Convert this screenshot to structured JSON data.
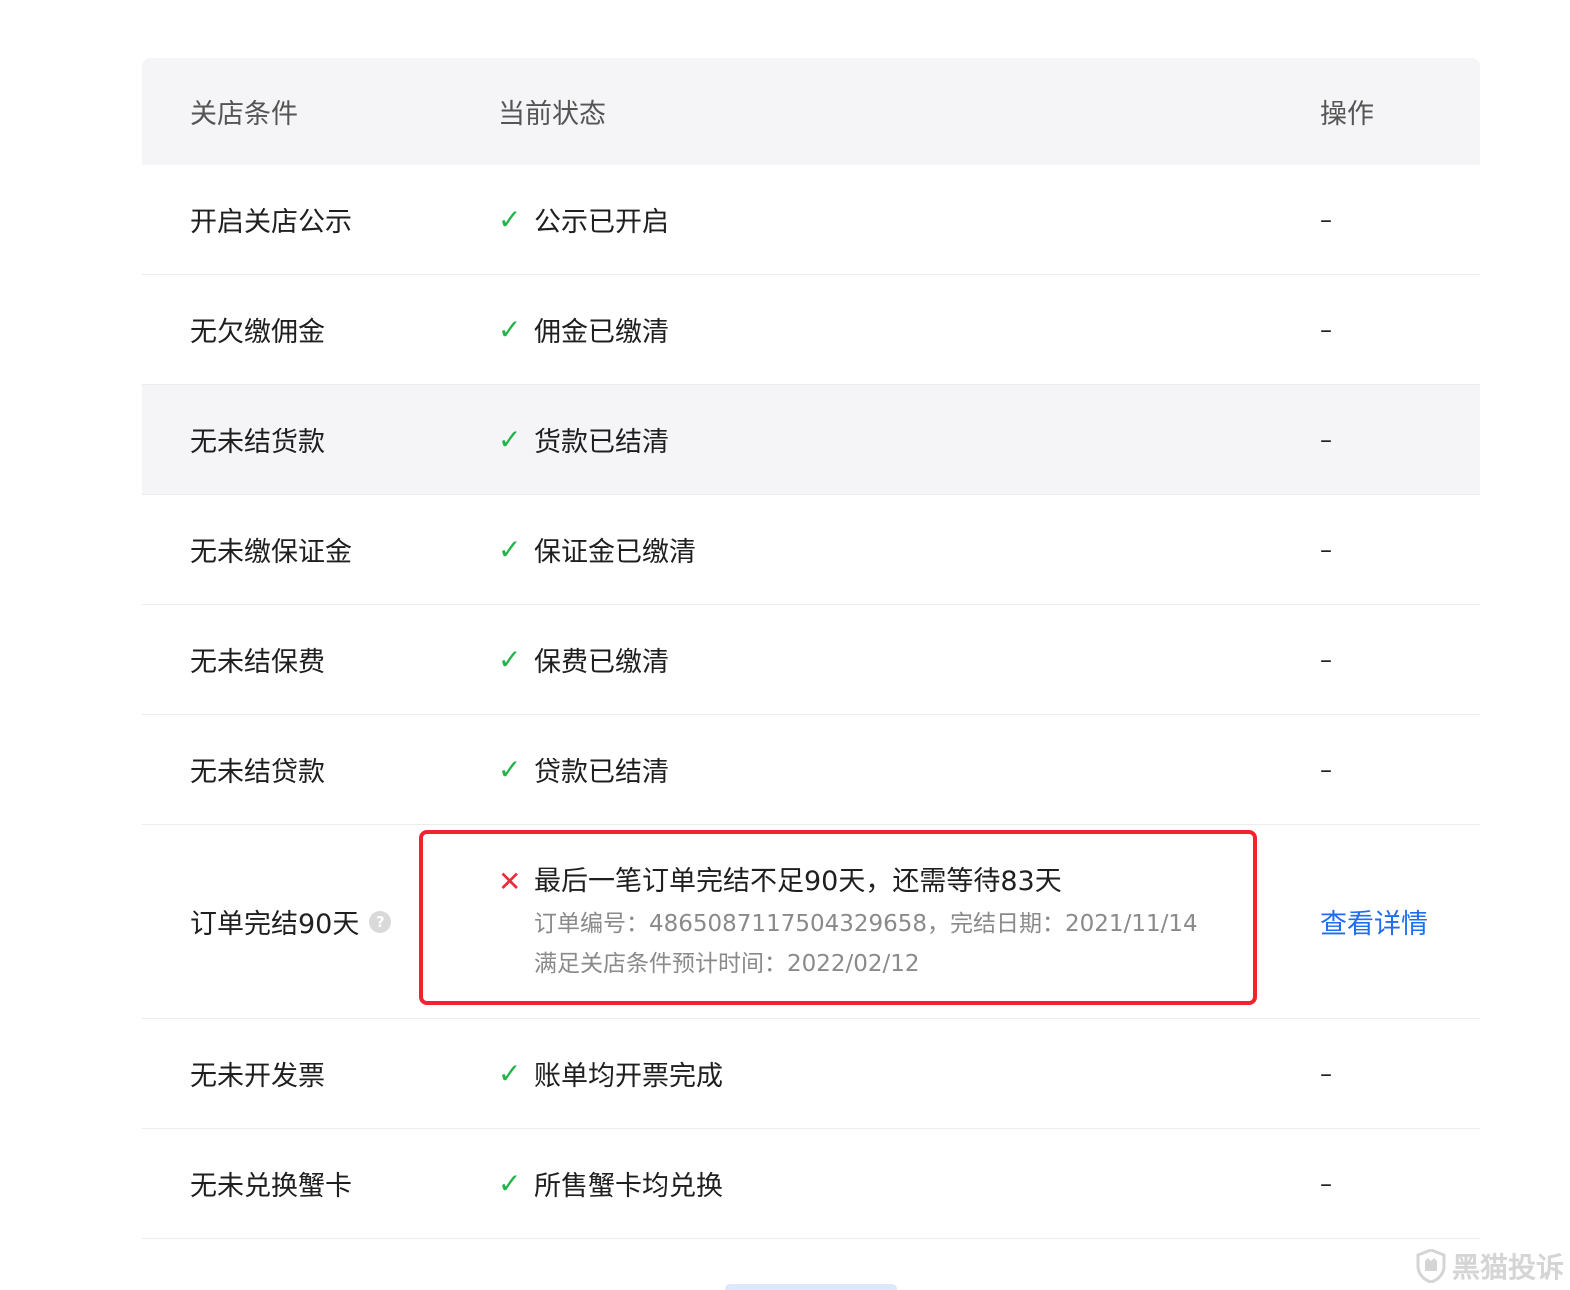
{
  "header": {
    "col_condition": "关店条件",
    "col_status": "当前状态",
    "col_action": "操作"
  },
  "rows": [
    {
      "condition": "开启关店公示",
      "status": "公示已开启",
      "action": "–"
    },
    {
      "condition": "无欠缴佣金",
      "status": "佣金已缴清",
      "action": "–"
    },
    {
      "condition": "无未结货款",
      "status": "货款已结清",
      "action": "–"
    },
    {
      "condition": "无未缴保证金",
      "status": "保证金已缴清",
      "action": "–"
    },
    {
      "condition": "无未结保费",
      "status": "保费已缴清",
      "action": "–"
    },
    {
      "condition": "无未结贷款",
      "status": "贷款已结清",
      "action": "–"
    },
    {
      "condition": "订单完结90天",
      "help": "?",
      "status": "最后一笔订单完结不足90天，还需等待83天",
      "detail_order": "订单编号：4865087117504329658，完结日期：2021/11/14",
      "detail_expected": "满足关店条件预计时间：2022/02/12",
      "action": "查看详情"
    },
    {
      "condition": "无未开发票",
      "status": "账单均开票完成",
      "action": "–"
    },
    {
      "condition": "无未兑换蟹卡",
      "status": "所售蟹卡均兑换",
      "action": "–"
    }
  ],
  "icons": {
    "ok": "✓",
    "fail": "✕"
  },
  "colors": {
    "ok": "#22b44a",
    "fail": "#ee2b3b",
    "link": "#1d6ef0",
    "highlight": "#f2232f"
  },
  "watermark": "黑猫投诉"
}
